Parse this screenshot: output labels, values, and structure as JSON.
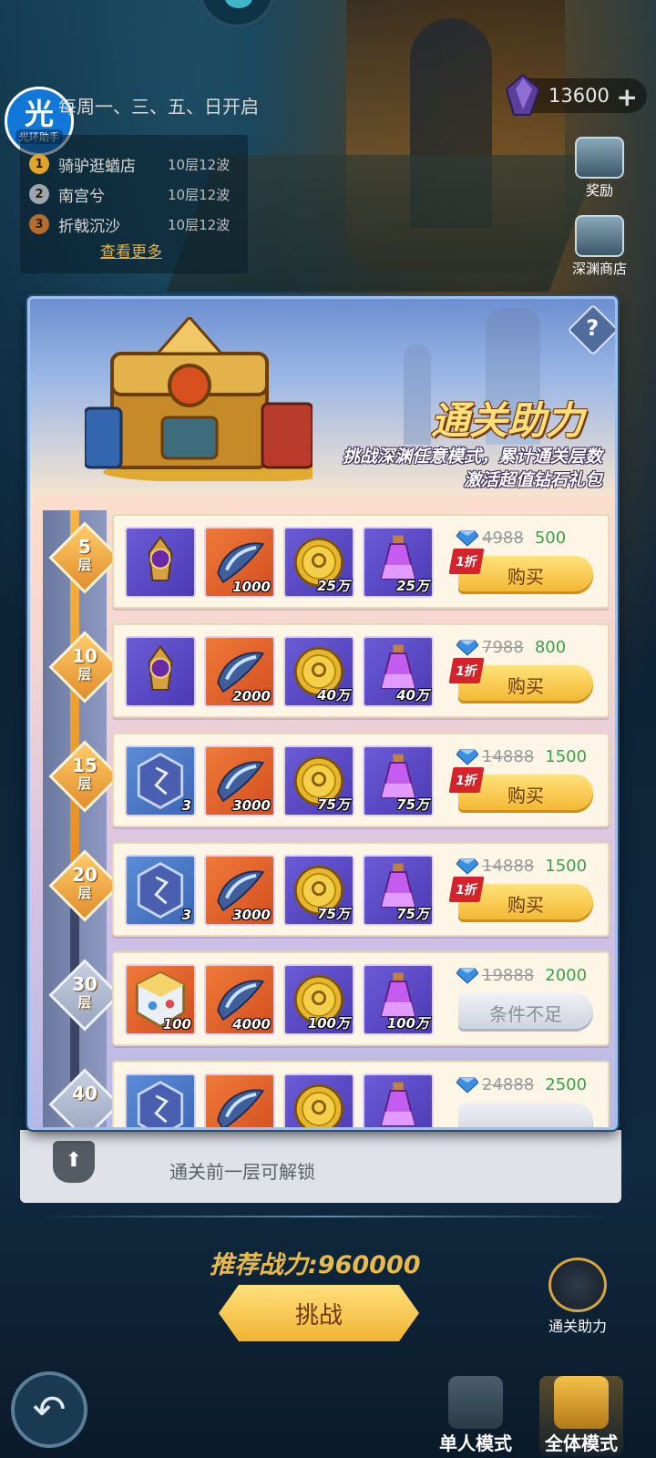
{
  "header": {
    "assistant_big": "光",
    "assistant_small": "光环助手",
    "open_days": "每周一、三、五、日开启",
    "ranking": [
      {
        "rank": "1",
        "name": "骑驴逛蝤店",
        "score": "10层12波"
      },
      {
        "rank": "2",
        "name": "南宫兮",
        "score": "10层12波"
      },
      {
        "rank": "3",
        "name": "折戟沉沙",
        "score": "10层12波"
      }
    ],
    "more_link": "查看更多",
    "currency_value": "13600",
    "currency_plus": "+"
  },
  "side_buttons": {
    "reward": "奖励",
    "shop": "深渊商店"
  },
  "modal": {
    "help": "?",
    "title": "通关助力",
    "subtitle_line1": "挑战深渊任意模式，累计通关层数",
    "subtitle_line2": "激活超值钻石礼包",
    "tiers": [
      {
        "level": "5",
        "unit": "层",
        "reached": true,
        "items": [
          {
            "icon": "gear-medal-icon",
            "color": "purple",
            "amount": ""
          },
          {
            "icon": "crystal-shard-icon",
            "color": "orange",
            "amount": "1000"
          },
          {
            "icon": "gold-coin-icon",
            "color": "purple",
            "amount": "25万"
          },
          {
            "icon": "potion-icon",
            "color": "purple",
            "amount": "25万"
          }
        ],
        "old_price": "4988",
        "new_price": "500",
        "discount": "1折",
        "button": "购买",
        "disabled": false
      },
      {
        "level": "10",
        "unit": "层",
        "reached": true,
        "items": [
          {
            "icon": "gear-medal-icon",
            "color": "purple",
            "amount": ""
          },
          {
            "icon": "crystal-shard-icon",
            "color": "orange",
            "amount": "2000"
          },
          {
            "icon": "gold-coin-icon",
            "color": "purple",
            "amount": "40万"
          },
          {
            "icon": "potion-icon",
            "color": "purple",
            "amount": "40万"
          }
        ],
        "old_price": "7988",
        "new_price": "800",
        "discount": "1折",
        "button": "购买",
        "disabled": false
      },
      {
        "level": "15",
        "unit": "层",
        "reached": true,
        "items": [
          {
            "icon": "rune-stone-icon",
            "color": "blue",
            "amount": "3"
          },
          {
            "icon": "crystal-shard-icon",
            "color": "orange",
            "amount": "3000"
          },
          {
            "icon": "gold-coin-icon",
            "color": "purple",
            "amount": "75万"
          },
          {
            "icon": "potion-icon",
            "color": "purple",
            "amount": "75万"
          }
        ],
        "old_price": "14888",
        "new_price": "1500",
        "discount": "1折",
        "button": "购买",
        "disabled": false
      },
      {
        "level": "20",
        "unit": "层",
        "reached": true,
        "items": [
          {
            "icon": "rune-stone-icon",
            "color": "blue",
            "amount": "3"
          },
          {
            "icon": "crystal-shard-icon",
            "color": "orange",
            "amount": "3000"
          },
          {
            "icon": "gold-coin-icon",
            "color": "purple",
            "amount": "75万"
          },
          {
            "icon": "potion-icon",
            "color": "purple",
            "amount": "75万"
          }
        ],
        "old_price": "14888",
        "new_price": "1500",
        "discount": "1折",
        "button": "购买",
        "disabled": false
      },
      {
        "level": "30",
        "unit": "层",
        "reached": false,
        "items": [
          {
            "icon": "treasure-cube-icon",
            "color": "orange",
            "amount": "100"
          },
          {
            "icon": "crystal-shard-icon",
            "color": "orange",
            "amount": "4000"
          },
          {
            "icon": "gold-coin-icon",
            "color": "purple",
            "amount": "100万"
          },
          {
            "icon": "potion-icon",
            "color": "purple",
            "amount": "100万"
          }
        ],
        "old_price": "19888",
        "new_price": "2000",
        "discount": "",
        "button": "条件不足",
        "disabled": true
      },
      {
        "level": "40",
        "unit": "",
        "reached": false,
        "items": [
          {
            "icon": "rune-stone-icon",
            "color": "blue",
            "amount": ""
          },
          {
            "icon": "crystal-shard-icon",
            "color": "orange",
            "amount": ""
          },
          {
            "icon": "gold-coin-icon",
            "color": "purple",
            "amount": ""
          },
          {
            "icon": "potion-icon",
            "color": "purple",
            "amount": ""
          }
        ],
        "old_price": "24888",
        "new_price": "2500",
        "discount": "",
        "button": "",
        "disabled": true
      }
    ]
  },
  "bottom": {
    "lock_icon": "lock-icon",
    "lock_text": "通关前一层可解锁",
    "recommended_power": "推荐战力:960000",
    "challenge": "挑战",
    "back_icon": "back-arrow-icon",
    "pass_help": "通关助力",
    "mode_single": "单人模式",
    "mode_all": "全体模式"
  },
  "colors": {
    "gold_accent": "#e8ba4c",
    "discount_red": "#d4232b",
    "price_green": "#3aa24a"
  }
}
